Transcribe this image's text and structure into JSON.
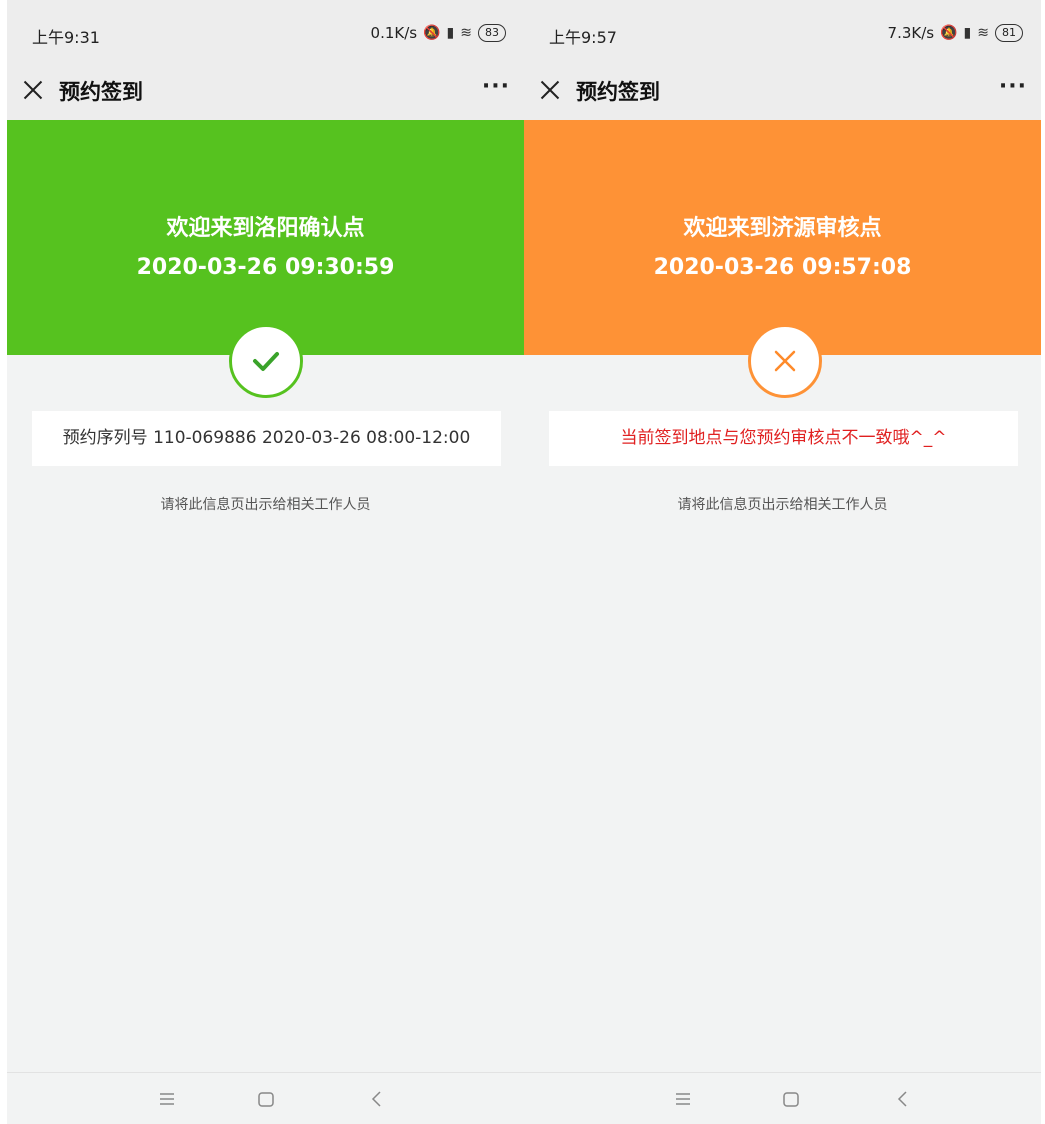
{
  "screens": [
    {
      "status_bar": {
        "time": "上午9:31",
        "net_speed": "0.1K/s",
        "battery": "83"
      },
      "title_bar": {
        "title": "预约签到"
      },
      "banner": {
        "title": "欢迎来到洛阳确认点",
        "timestamp": "2020-03-26 09:30:59",
        "color": "#56c21f"
      },
      "result": {
        "icon": "check-icon",
        "state": "success"
      },
      "info_box": {
        "text": "预约序列号 110-069886 2020-03-26 08:00-12:00",
        "color": "#333333"
      },
      "hint": "请将此信息页出示给相关工作人员"
    },
    {
      "status_bar": {
        "time": "上午9:57",
        "net_speed": "7.3K/s",
        "battery": "81"
      },
      "title_bar": {
        "title": "预约签到"
      },
      "banner": {
        "title": "欢迎来到济源审核点",
        "timestamp": "2020-03-26 09:57:08",
        "color": "#fe9236"
      },
      "result": {
        "icon": "cross-icon",
        "state": "error"
      },
      "info_box": {
        "text": "当前签到地点与您预约审核点不一致哦^_^",
        "color": "#e02020"
      },
      "hint": "请将此信息页出示给相关工作人员"
    }
  ]
}
